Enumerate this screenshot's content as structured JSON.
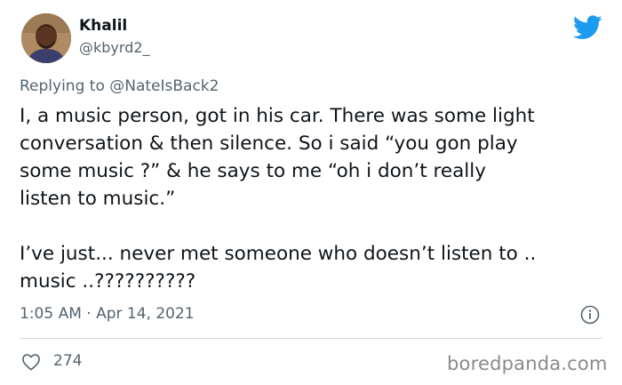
{
  "author": {
    "name": "Khalil",
    "handle": "@kbyrd2_"
  },
  "reply": {
    "prefix": "Replying to ",
    "mention": "@NateIsBack2"
  },
  "tweet": {
    "text": "I, a music person, got in his car. There was some light\nconversation & then silence. So i said “you gon play\nsome music ?” & he says to me “oh i don’t really\nlisten to music.”\n\nI’ve just... never met someone who doesn’t listen to ..\nmusic ..??????????",
    "timestamp": "1:05 AM · Apr 14, 2021"
  },
  "engagement": {
    "likes": "274"
  },
  "watermark": "boredpanda.com",
  "icons": {
    "brand": "twitter-bird-icon",
    "info": "info-icon",
    "like": "heart-icon"
  },
  "colors": {
    "twitter_blue": "#1d9bf0",
    "secondary_text": "#536471",
    "primary_text": "#0f1419"
  }
}
